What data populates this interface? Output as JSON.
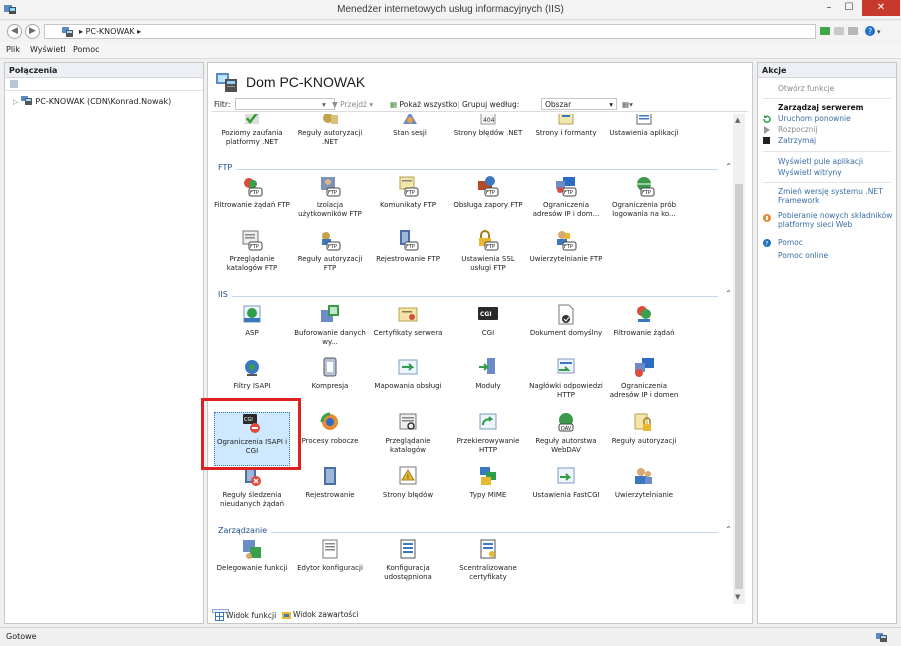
{
  "window": {
    "title": "Menedżer internetowych usług informacyjnych (IIS)"
  },
  "address": {
    "crumb": "PC-KNOWAK",
    "arrow": "▸"
  },
  "menu": {
    "file": "Plik",
    "view": "Wyświetl",
    "help": "Pomoc"
  },
  "connections": {
    "header": "Połączenia",
    "node": "PC-KNOWAK (CDN\\Konrad.Nowak)"
  },
  "home": {
    "title": "Dom PC-KNOWAK"
  },
  "filter": {
    "label": "Filtr:",
    "go": "Przejdź",
    "show_all": "Pokaż wszystko",
    "group_by": "Grupuj według:",
    "group_value": "Obszar"
  },
  "sections": {
    "ftp": "FTP",
    "iis": "IIS",
    "management": "Zarządzanie"
  },
  "tiles_top": [
    "Poziomy zaufania platformy .NET",
    "Reguły autoryzacji .NET",
    "Stan sesji",
    "Strony błędów .NET",
    "Strony i formanty",
    "Ustawienia aplikacji"
  ],
  "tiles_ftp": [
    "Filtrowanie żądań FTP",
    "Izolacja użytkowników FTP",
    "Komunikaty FTP",
    "Obsługa zapory FTP",
    "Ograniczenia adresów IP i dom...",
    "Ograniczenia prób logowania na ko...",
    "Przeglądanie katalogów FTP",
    "Reguły autoryzacji FTP",
    "Rejestrowanie FTP",
    "Ustawienia SSL usługi FTP",
    "Uwierzytelnianie FTP"
  ],
  "tiles_iis": [
    "ASP",
    "Buforowanie danych wy...",
    "Certyfikaty serwera",
    "CGI",
    "Dokument domyślny",
    "Filtrowanie żądań",
    "Filtry ISAPI",
    "Kompresja",
    "Mapowania obsługi",
    "Moduły",
    "Nagłówki odpowiedzi HTTP",
    "Ograniczenia adresów IP i domen",
    "Ograniczenia ISAPI i CGI",
    "Procesy robocze",
    "Przeglądanie katalogów",
    "Przekierowywanie HTTP",
    "Reguły autorstwa WebDAV",
    "Reguły autoryzacji",
    "Reguły śledzenia nieudanych żądań",
    "Rejestrowanie",
    "Strony błędów",
    "Typy MIME",
    "Ustawienia FastCGI",
    "Uwierzytelnianie"
  ],
  "tiles_mgmt": [
    "Delegowanie funkcji",
    "Edytor konfiguracji",
    "Konfiguracja udostępniona",
    "Scentralizowane certyfikaty"
  ],
  "view_tabs": {
    "features": "Widok funkcji",
    "content": "Widok zawartości"
  },
  "actions": {
    "header": "Akcje",
    "open_feature": "Otwórz funkcje",
    "manage_server": "Zarządzaj serwerem",
    "restart": "Uruchom ponownie",
    "start": "Rozpocznij",
    "stop": "Zatrzymaj",
    "view_pools": "Wyświetl pule aplikacji",
    "view_sites": "Wyświetl witryny",
    "change_net_1": "Zmień wersję systemu .NET",
    "change_net_2": "Framework",
    "get_new_1": "Pobieranie nowych składników",
    "get_new_2": "platformy sieci Web",
    "help": "Pomoc",
    "help_online": "Pomoc online"
  },
  "status": {
    "text": "Gotowe"
  },
  "colors": {
    "accent": "#1f4e8c",
    "link": "#3a6ea5",
    "highlight": "#e02020",
    "close": "#c7392c"
  }
}
